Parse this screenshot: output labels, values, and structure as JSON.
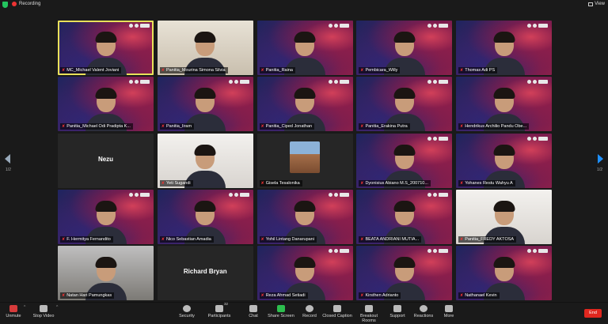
{
  "topbar": {
    "recording_label": "Recording",
    "view_label": "View"
  },
  "pager": {
    "left": "1/2",
    "right": "1/2"
  },
  "tiles": [
    {
      "name": "MC_Michael Valent Joviani",
      "style": "bg active"
    },
    {
      "name": "Panitia_Mourina Simona Silvia",
      "style": "room"
    },
    {
      "name": "Panitia_Raina",
      "style": "bg"
    },
    {
      "name": "Pembicara_Willy",
      "style": "bg"
    },
    {
      "name": "Thomas Adi PS",
      "style": "bg"
    },
    {
      "name": "Panitia_Michael Odi Pradipta K...",
      "style": "bg"
    },
    {
      "name": "Panitia_Iiram",
      "style": "bg"
    },
    {
      "name": "Panitia_Ciped Jonathan",
      "style": "bg"
    },
    {
      "name": "Panitia_Erakina Putra",
      "style": "bg"
    },
    {
      "name": "Hendrikus Archilio Pandu Obe...",
      "style": "bg"
    },
    {
      "name": "",
      "display": "Nezu",
      "style": "plain"
    },
    {
      "name": "Yeti Sugandi",
      "style": "bright"
    },
    {
      "name": "Gisela Tesalonika",
      "style": "plain building"
    },
    {
      "name": "Dyonisius Abiano M.S_200710...",
      "style": "bg"
    },
    {
      "name": "Yohanes Restu Wahyu A",
      "style": "bg"
    },
    {
      "name": "F. Hermitya Fernandito",
      "style": "bg"
    },
    {
      "name": "Nico Sebastian Amadia",
      "style": "bg"
    },
    {
      "name": "Yohil Lintang Danarupani",
      "style": "bg"
    },
    {
      "name": "BEATA ANDRIANI MUTIA...",
      "style": "bg"
    },
    {
      "name": "Panitia_FREDY AKTOSA",
      "style": "bright"
    },
    {
      "name": "Natan Hari Pamungkas",
      "style": "dim"
    },
    {
      "name": "",
      "display": "Richard Bryan",
      "style": "plain"
    },
    {
      "name": "Reza Ahmad Setiadi",
      "style": "bg"
    },
    {
      "name": "Kirsthen Adrianto",
      "style": "bg"
    },
    {
      "name": "Nathanael Kevin",
      "style": "bg"
    }
  ],
  "toolbar": {
    "unmute": "Unmute",
    "stop_video": "Stop Video",
    "security": "Security",
    "participants": "Participants",
    "participants_count": "32",
    "chat": "Chat",
    "share_screen": "Share Screen",
    "record": "Record",
    "closed_caption": "Closed Caption",
    "breakout_rooms": "Breakout Rooms",
    "support": "Support",
    "reactions": "Reactions",
    "more": "More",
    "end": "End"
  },
  "colors": {
    "share_screen_accent": "#2dbe4e",
    "end_button": "#e0271f",
    "active_speaker_border": "#e9e15a",
    "nav_arrow_right": "#1e90ff"
  }
}
